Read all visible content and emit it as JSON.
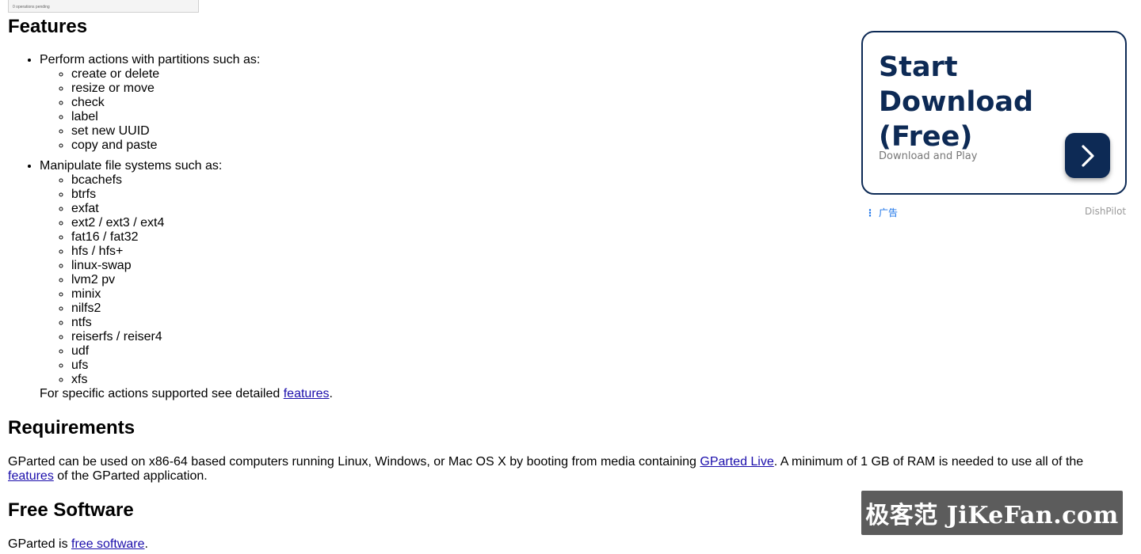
{
  "top_image_caption": "0 operations pending",
  "features": {
    "heading": "Features",
    "partitions_intro": "Perform actions with partitions such as:",
    "partition_actions": [
      "create or delete",
      "resize or move",
      "check",
      "label",
      "set new UUID",
      "copy and paste"
    ],
    "fs_intro": "Manipulate file systems such as:",
    "file_systems": [
      "bcachefs",
      "btrfs",
      "exfat",
      "ext2 / ext3 / ext4",
      "fat16 / fat32",
      "hfs / hfs+",
      "linux-swap",
      "lvm2 pv",
      "minix",
      "nilfs2",
      "ntfs",
      "reiserfs / reiser4",
      "udf",
      "ufs",
      "xfs"
    ],
    "note_prefix": "For specific actions supported see detailed ",
    "note_link": "features",
    "note_suffix": "."
  },
  "requirements": {
    "heading": "Requirements",
    "text_1": "GParted can be used on x86-64 based computers running Linux, Windows, or Mac OS X by booting from media containing ",
    "link_1": "GParted Live",
    "text_2": ". A minimum of 1 GB of RAM is needed to use all of the ",
    "link_2": "features",
    "text_3": " of the GParted application."
  },
  "free_software": {
    "heading": "Free Software",
    "text_1": "GParted is ",
    "link_1": "free software",
    "text_2": "."
  },
  "ad": {
    "title": "Start Download (Free)",
    "subtitle": "Download and Play",
    "ad_label": "广告",
    "brand": "DishPilot",
    "accent_color": "#0d2a55"
  },
  "watermark": "极客范 JiKeFan.com"
}
